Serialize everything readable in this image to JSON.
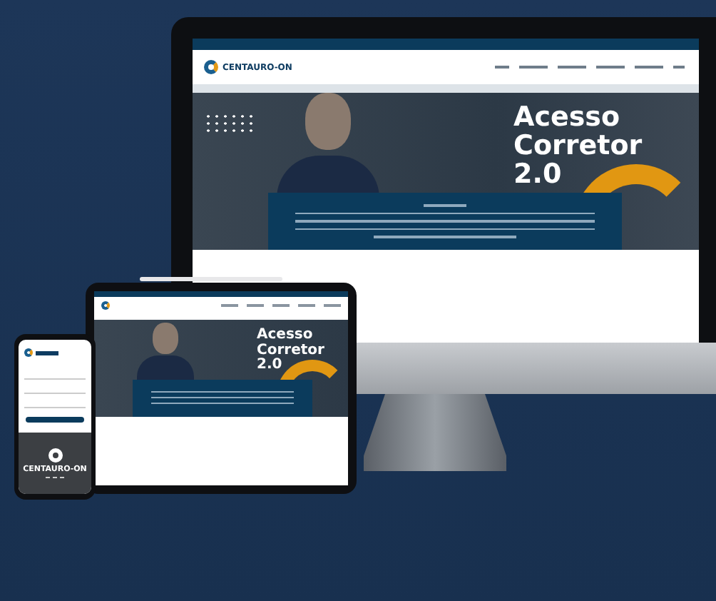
{
  "desktop": {
    "logo_text": "CENTAURO-ON",
    "hero_title": "Acesso Corretor 2.0"
  },
  "tablet": {
    "hero_title": "Acesso Corretor 2.0"
  },
  "phone": {
    "brand": "CENTAURO-ON"
  }
}
